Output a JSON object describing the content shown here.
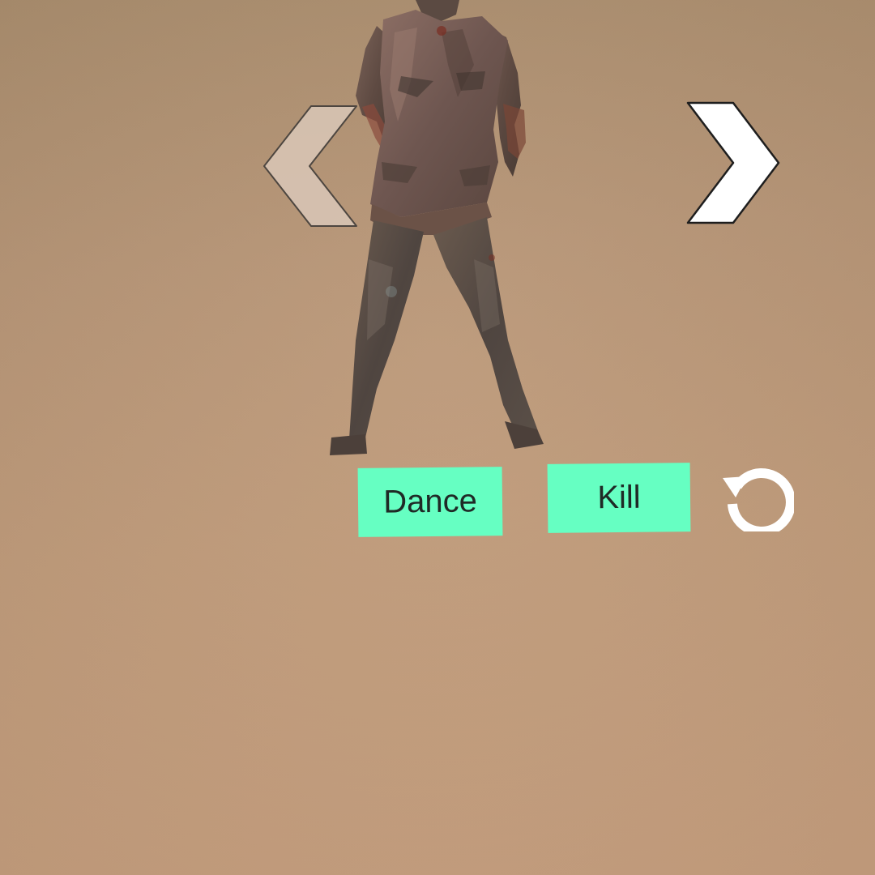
{
  "scene": {
    "background_color": "#c19c7b"
  },
  "character": {
    "icon": "zombie-character"
  },
  "navigation": {
    "prev_icon": "chevron-left-icon",
    "next_icon": "chevron-right-icon"
  },
  "actions": {
    "dance_label": "Dance",
    "kill_label": "Kill",
    "button_color": "#66ffc2",
    "reset_icon": "reset-icon"
  }
}
